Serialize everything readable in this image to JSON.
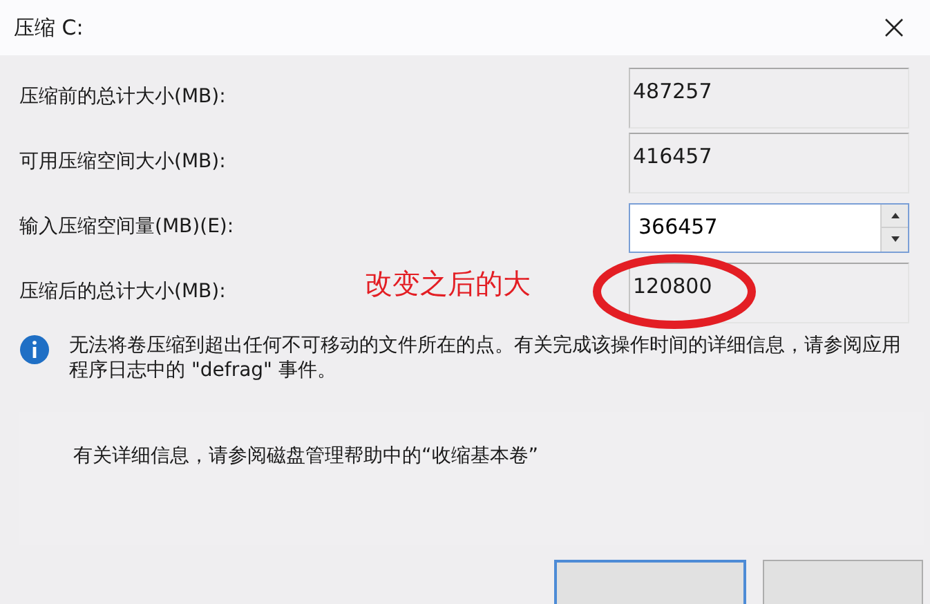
{
  "window": {
    "title": "压缩 C:"
  },
  "fields": [
    {
      "label": "压缩前的总计大小(MB):",
      "value": "487257",
      "kind": "readonly"
    },
    {
      "label": "可用压缩空间大小(MB):",
      "value": "416457",
      "kind": "readonly"
    },
    {
      "label": "输入压缩空间量(MB)(E):",
      "value": "366457",
      "kind": "spin"
    },
    {
      "label": "压缩后的总计大小(MB):",
      "value": "120800",
      "kind": "readonly"
    }
  ],
  "annotation": {
    "text": "改变之后的大"
  },
  "info": {
    "text": "无法将卷压缩到超出任何不可移动的文件所在的点。有关完成该操作时间的详细信息，请参阅应用程序日志中的 \"defrag\" 事件。"
  },
  "help": {
    "text": "有关详细信息，请参阅磁盘管理帮助中的“收缩基本卷”"
  },
  "buttons": [
    {
      "kind": "default"
    },
    {
      "kind": "normal"
    }
  ]
}
